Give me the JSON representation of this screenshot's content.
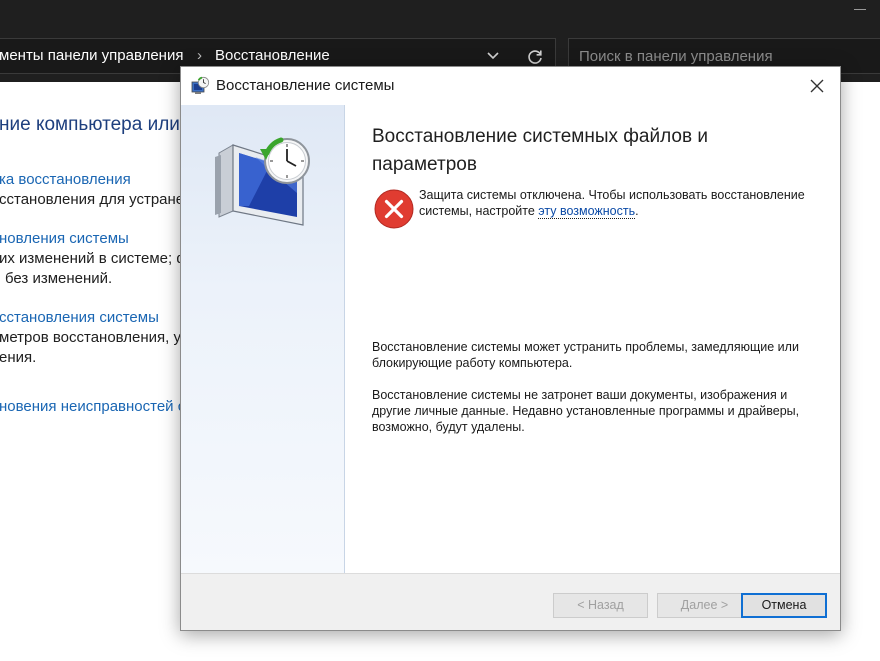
{
  "background_window": {
    "breadcrumb": [
      "менты панели управления",
      "Восстановление"
    ],
    "breadcrumb_separator": "›",
    "search_placeholder": "Поиск в панели управления",
    "heading": "ние компьютера или",
    "items": [
      {
        "link": "ка восстановления",
        "lines": [
          "сстановления для устране"
        ]
      },
      {
        "link": "новления системы",
        "lines": [
          "их изменений в системе; ф",
          "без изменений."
        ]
      },
      {
        "link": "сстановления системы",
        "lines": [
          "метров восстановления, у",
          "ения."
        ]
      },
      {
        "link": "новения неисправностей с",
        "lines": []
      }
    ]
  },
  "dialog": {
    "title": "Восстановление системы",
    "heading": "Восстановление системных файлов и параметров",
    "error_text": "Защита системы отключена. Чтобы использовать восстановление системы, настройте ",
    "error_link": "эту возможность",
    "error_end": ".",
    "paragraph_1": "Восстановление системы может устранить проблемы, замедляющие или блокирующие работу компьютера.",
    "paragraph_2": "Восстановление системы не затронет ваши документы, изображения и другие личные данные. Недавно установленные программы и драйверы, возможно, будут удалены.",
    "buttons": {
      "back": "< Назад",
      "next": "Далее >",
      "cancel": "Отмена"
    }
  },
  "colors": {
    "accent": "#0f6fd3",
    "link": "#1a66b3",
    "error": "#e03c31",
    "titlebar_dark": "#1f1f1f"
  }
}
